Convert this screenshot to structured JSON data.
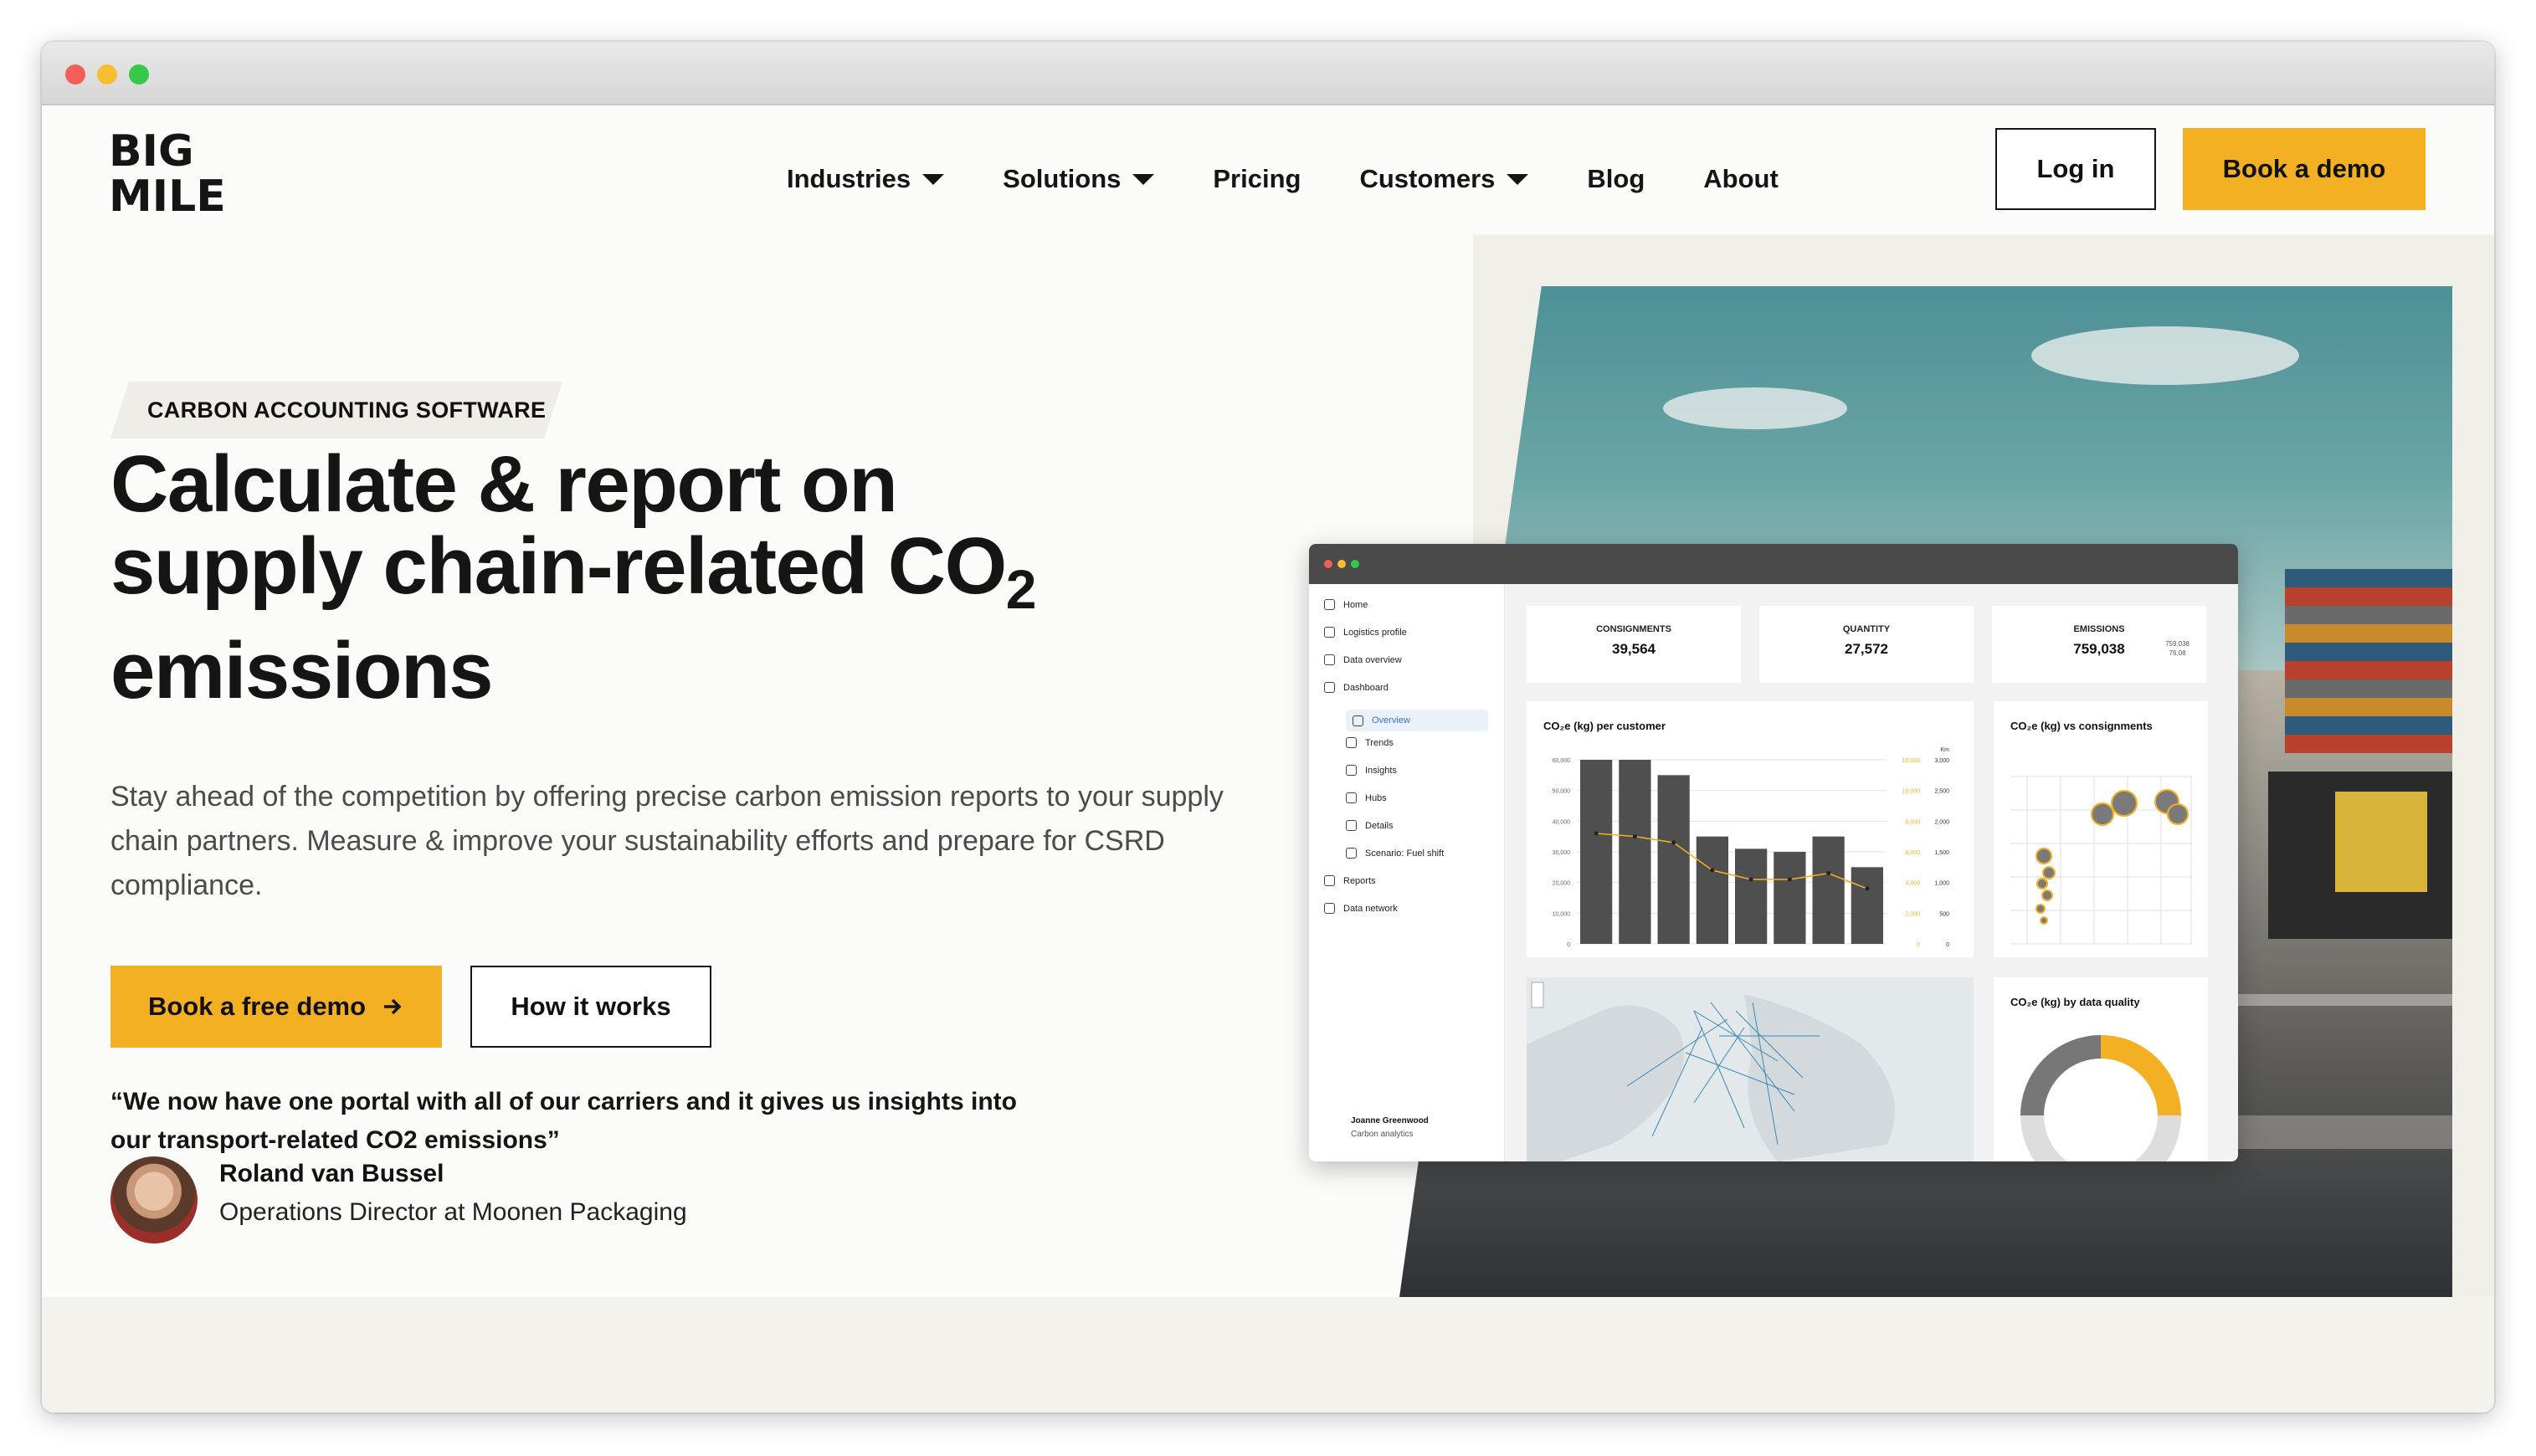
{
  "header": {
    "logo_text": "BIG MILE",
    "nav": [
      {
        "label": "Industries",
        "has_dropdown": true
      },
      {
        "label": "Solutions",
        "has_dropdown": true
      },
      {
        "label": "Pricing",
        "has_dropdown": false
      },
      {
        "label": "Customers",
        "has_dropdown": true
      },
      {
        "label": "Blog",
        "has_dropdown": false
      },
      {
        "label": "About",
        "has_dropdown": false
      }
    ],
    "login_label": "Log in",
    "demo_label": "Book a demo"
  },
  "hero": {
    "tag": "CARBON ACCOUNTING SOFTWARE",
    "headline_line1": "Calculate & report on",
    "headline_line2": "supply chain-related CO",
    "headline_sub": "2",
    "headline_line3": "emissions",
    "lead": "Stay ahead of the competition by offering precise carbon emission reports to your supply chain partners. Measure & improve your sustainability efforts and prepare for CSRD compliance.",
    "primary_cta": "Book a free demo",
    "secondary_cta": "How it works"
  },
  "testimonial": {
    "quote": "“We now have one portal with all of our carriers and it gives us insights into our transport-related CO2 emissions”",
    "name": "Roland van Bussel",
    "role": "Operations Director at Moonen Packaging"
  },
  "dashboard": {
    "sidebar": [
      {
        "label": "Home",
        "sub": false,
        "icon": "home-icon"
      },
      {
        "label": "Logistics profile",
        "sub": false,
        "icon": "profile-icon"
      },
      {
        "label": "Data overview",
        "sub": false,
        "icon": "document-icon"
      },
      {
        "label": "Dashboard",
        "sub": false,
        "icon": "dashboard-icon"
      },
      {
        "label": "Overview",
        "sub": true,
        "icon": "overview-icon",
        "active": true
      },
      {
        "label": "Trends",
        "sub": true,
        "icon": "trend-icon"
      },
      {
        "label": "Insights",
        "sub": true,
        "icon": "insights-icon"
      },
      {
        "label": "Hubs",
        "sub": true,
        "icon": "hub-icon"
      },
      {
        "label": "Details",
        "sub": true,
        "icon": "list-icon"
      },
      {
        "label": "Scenario: Fuel shift",
        "sub": true,
        "icon": "scenario-icon"
      },
      {
        "label": "Reports",
        "sub": false,
        "icon": "report-icon"
      },
      {
        "label": "Data network",
        "sub": false,
        "icon": "network-icon"
      }
    ],
    "user_name": "Joanne Greenwood",
    "user_role": "Carbon analytics",
    "kpis": [
      {
        "label": "CONSIGNMENTS",
        "value": "39,564"
      },
      {
        "label": "QUANTITY",
        "value": "27,572"
      },
      {
        "label": "EMISSIONS",
        "value": "759,038",
        "extra1": "759,038",
        "extra2": "76,08"
      }
    ],
    "panels": {
      "per_customer": "CO₂e (kg) per customer",
      "vs_consignments": "CO₂e (kg) vs consignments",
      "by_quality": "CO₂e (kg) by data quality"
    },
    "colors": {
      "accent": "#f4b023",
      "bar": "#4f4f4f",
      "dark": "#151515"
    }
  },
  "chart_data": {
    "type": "bar",
    "title": "CO₂e (kg) per customer",
    "y_ticks": [
      "60,000",
      "50,000",
      "40,000",
      "30,000",
      "20,000",
      "10,000",
      "0"
    ],
    "y2_header": "Km",
    "y2_ticks": [
      "3,000",
      "2,500",
      "2,000",
      "1,500",
      "1,000",
      "500",
      "0"
    ],
    "y3_ticks": [
      "10,000",
      "10,000",
      "8,000",
      "6,000",
      "4,000",
      "2,000",
      "0"
    ],
    "ylim": [
      0,
      60000
    ],
    "values": [
      60000,
      60000,
      55000,
      35000,
      31000,
      30000,
      35000,
      25000
    ],
    "line_values": [
      36000,
      35000,
      33000,
      24000,
      21000,
      21000,
      23000,
      18000
    ]
  }
}
